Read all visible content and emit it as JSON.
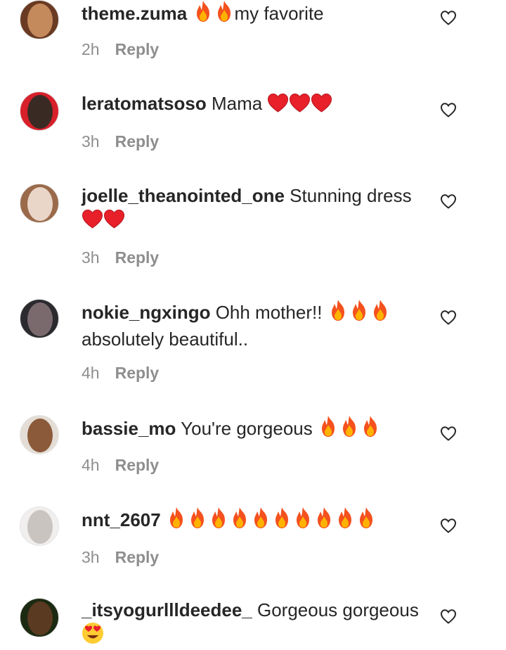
{
  "comments": [
    {
      "username": "theme.zuma",
      "text_before": " ",
      "emoji": [
        "fire",
        "fire"
      ],
      "text_after": "my favorite",
      "time": "2h",
      "reply": "Reply",
      "avatar_colors": [
        "#6a3a22",
        "#c58a5c"
      ]
    },
    {
      "username": "leratomatsoso",
      "text_before": " Mama ",
      "emoji": [
        "heart",
        "heart",
        "heart"
      ],
      "text_after": "",
      "time": "3h",
      "reply": "Reply",
      "avatar_colors": [
        "#d7202a",
        "#3a2a24"
      ]
    },
    {
      "username": "joelle_theanointed_one",
      "text_before": " Stunning dress",
      "emoji": [
        "heart",
        "heart"
      ],
      "text_after": "",
      "time": "3h",
      "reply": "Reply",
      "avatar_colors": [
        "#9a6a4a",
        "#e9d6c8"
      ]
    },
    {
      "username": "nokie_ngxingo",
      "text_before": " Ohh mother!! ",
      "emoji": [
        "fire",
        "fire",
        "fire"
      ],
      "text_after": "absolutely beautiful..",
      "time": "4h",
      "reply": "Reply",
      "avatar_colors": [
        "#2b2a2e",
        "#7a6a6e"
      ]
    },
    {
      "username": "bassie_mo",
      "text_before": " You're gorgeous ",
      "emoji": [
        "fire",
        "fire",
        "fire"
      ],
      "text_after": "",
      "time": "4h",
      "reply": "Reply",
      "avatar_colors": [
        "#e4ddd6",
        "#8b5a3a"
      ]
    },
    {
      "username": "nnt_2607",
      "text_before": " ",
      "emoji": [
        "fire",
        "fire",
        "fire",
        "fire",
        "fire",
        "fire",
        "fire",
        "fire",
        "fire",
        "fire"
      ],
      "text_after": "",
      "time": "3h",
      "reply": "Reply",
      "avatar_colors": [
        "#f1eeee",
        "#c9c4c0"
      ]
    },
    {
      "username": "_itsyogurllldeedee_",
      "text_before": " Gorgeous gorgeous",
      "emoji": [
        "heart-eyes"
      ],
      "text_after": "",
      "time": "",
      "reply": "",
      "avatar_colors": [
        "#1c2a12",
        "#5a3a20"
      ]
    }
  ],
  "icons": {
    "like": "heart-outline-icon",
    "fire": "fire-emoji-icon",
    "heart": "red-heart-emoji-icon",
    "heart_eyes": "heart-eyes-emoji-icon"
  },
  "colors": {
    "text": "#262626",
    "muted": "#8e8e8e",
    "fire_outer": "#f4511e",
    "fire_inner": "#ffb300",
    "heart": "#e8202a"
  }
}
